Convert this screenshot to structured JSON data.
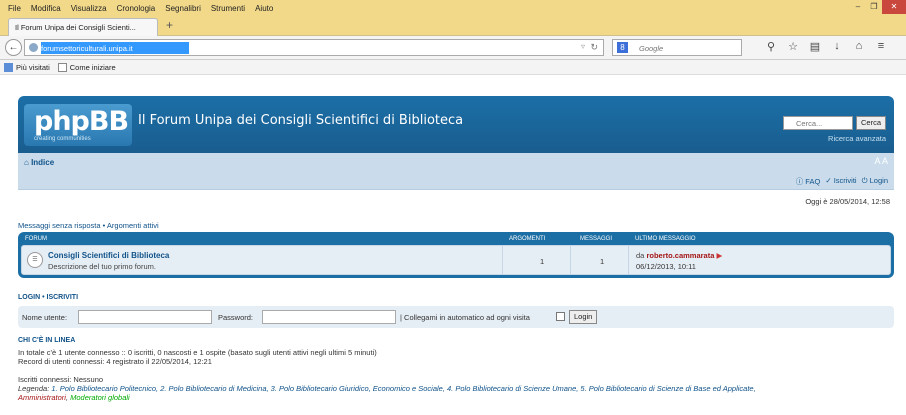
{
  "browser": {
    "menu": [
      "File",
      "Modifica",
      "Visualizza",
      "Cronologia",
      "Segnalibri",
      "Strumenti",
      "Aiuto"
    ],
    "tab_title": "Il Forum Unipa dei Consigli Scienti...",
    "url": "forumsettoriculturali.unipa.it",
    "search_placeholder": "Google",
    "bookmarks": [
      "Più visitati",
      "Come iniziare"
    ]
  },
  "forum": {
    "site_title": "Il Forum Unipa dei Consigli Scientifici di Biblioteca",
    "logo_text": "phpBB",
    "logo_subtext": "creating communities",
    "search_placeholder": "Cerca...",
    "search_button": "Cerca",
    "advanced_search": "Ricerca avanzata",
    "nav_home": "Indice",
    "links": {
      "faq": "FAQ",
      "register": "Iscriviti",
      "login": "Login"
    },
    "current_date": "Oggi è 28/05/2014, 12:58",
    "quick_links": "Messaggi senza risposta • Argomenti attivi",
    "table": {
      "headers": {
        "forum": "FORUM",
        "topics": "ARGOMENTI",
        "posts": "MESSAGGI",
        "last_post": "ULTIMO MESSAGGIO"
      },
      "rows": [
        {
          "name": "Consigli Scientifici di Biblioteca",
          "description": "Descrizione del tuo primo forum.",
          "topics": "1",
          "posts": "1",
          "last_by_prefix": "da",
          "last_author": "roberto.cammarata",
          "last_date": "06/12/2013, 10:11"
        }
      ]
    },
    "login": {
      "title": "LOGIN • ISCRIVITI",
      "username_label": "Nome utente:",
      "password_label": "Password:",
      "autologin_label": "| Collegami in automatico ad ogni visita",
      "login_button": "Login"
    },
    "online": {
      "title": "CHI C'È IN LINEA",
      "line1": "In totale c'è 1 utente connesso :: 0 iscritti, 0 nascosti e 1 ospite (basato sugli utenti attivi negli ultimi 5 minuti)",
      "line2": "Record di utenti connessi: 4 registrato il 22/05/2014, 12:21",
      "line3": "Iscritti connessi: Nessuno",
      "legend_label": "Legenda:",
      "legend_groups": "1. Polo Bibliotecario Politecnico, 2. Polo Bibliotecario di Medicina, 3. Polo Bibliotecario Giuridico, Economico e Sociale, 4. Polo Bibliotecario di Scienze Umane, 5. Polo Bibliotecario di Scienze di Base ed Applicate,",
      "legend_admin": "Amministratori",
      "legend_mods": "Moderatori globali"
    }
  }
}
